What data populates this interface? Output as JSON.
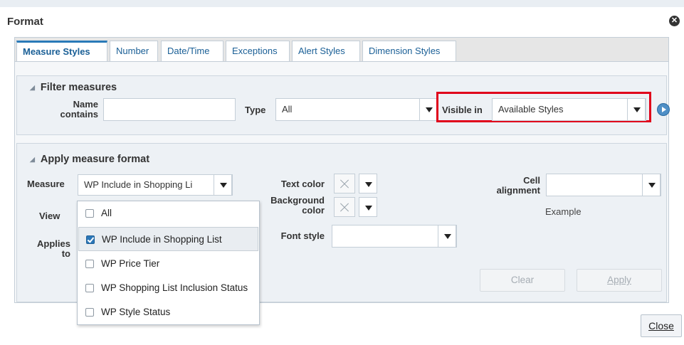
{
  "dialog": {
    "title": "Format",
    "close_label": "Close"
  },
  "tabs": [
    {
      "label": "Measure Styles",
      "active": true
    },
    {
      "label": "Number"
    },
    {
      "label": "Date/Time"
    },
    {
      "label": "Exceptions"
    },
    {
      "label": "Alert Styles"
    },
    {
      "label": "Dimension Styles"
    }
  ],
  "filter": {
    "heading": "Filter measures",
    "name_label_line1": "Name",
    "name_label_line2": "contains",
    "name_value": "",
    "type_label": "Type",
    "type_value": "All",
    "visible_label": "Visible in",
    "visible_value": "Available Styles"
  },
  "apply": {
    "heading": "Apply measure format",
    "measure_label": "Measure",
    "measure_value": "WP Include in Shopping Li",
    "view_label": "View",
    "applies_label_line1": "Applies",
    "applies_label_line2": "to",
    "text_color_label": "Text color",
    "bg_color_label_line1": "Background",
    "bg_color_label_line2": "color",
    "font_style_label": "Font style",
    "font_style_value": "",
    "cell_alignment_label_line1": "Cell",
    "cell_alignment_label_line2": "alignment",
    "cell_alignment_value": "",
    "example_label": "Example",
    "clear_label": "Clear",
    "apply_label": "Apply"
  },
  "measure_options": [
    {
      "label": "All",
      "checked": false
    },
    {
      "label": "WP Include in Shopping List",
      "checked": true
    },
    {
      "label": "WP Price Tier",
      "checked": false
    },
    {
      "label": "WP Shopping List Inclusion Status",
      "checked": false
    },
    {
      "label": "WP Style Status",
      "checked": false
    }
  ],
  "colors": {
    "highlight": "#e0001b",
    "accent": "#2a7ab8",
    "tab_text": "#1a5f96"
  },
  "icons": {
    "close": "close-circle-icon",
    "go": "play-circle-icon",
    "collapse": "triangle-down-icon",
    "dropdown": "caret-down-icon"
  }
}
